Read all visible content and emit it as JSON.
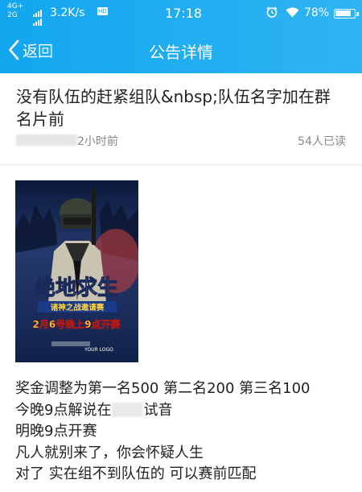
{
  "status_bar": {
    "network_top": "4G+",
    "network_bottom": "2G",
    "speed": "3.2K/s",
    "time": "17:18",
    "battery": "78%",
    "icons": [
      "signal-icon",
      "alarm-icon",
      "wifi-icon",
      "battery-icon"
    ]
  },
  "titlebar": {
    "back_label": "返回",
    "title": "公告详情",
    "color": "#1aa6ef"
  },
  "notice": {
    "title": "没有队伍的赶紧组队&nbsp;队伍名字加在群名片前",
    "time_ago": "2小时前",
    "reads": "54人已读"
  },
  "poster": {
    "title_text": "绝地求生",
    "subtitle": "诸神之战邀请赛",
    "date_line": "2月6号晚上9点开赛",
    "logo_text": "YOUR LOGO"
  },
  "body": {
    "line1": "奖金调整为第一名500 第二名200 第三名100",
    "line2_before": "今晚9点解说在",
    "line2_after": "试音",
    "line3": "明晚9点开赛",
    "line4": "凡人就别来了，你会怀疑人生",
    "line5": "对了 实在组不到队伍的 可以赛前匹配"
  }
}
